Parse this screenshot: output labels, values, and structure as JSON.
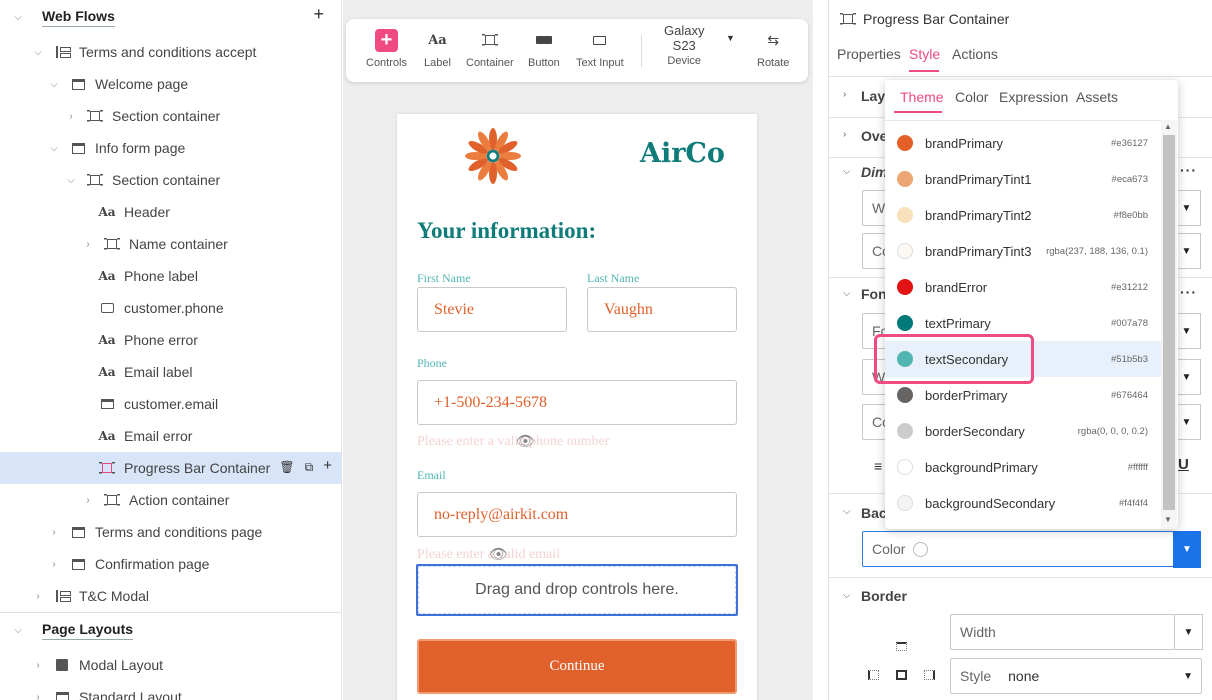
{
  "tree": {
    "web_flows": "Web Flows",
    "terms_flow": "Terms and conditions accept",
    "welcome_page": "Welcome page",
    "section_container_1": "Section container",
    "info_form_page": "Info form page",
    "section_container_2": "Section container",
    "header": "Header",
    "name_container": "Name container",
    "phone_label": "Phone label",
    "customer_phone": "customer.phone",
    "phone_error": "Phone error",
    "email_label": "Email label",
    "customer_email": "customer.email",
    "email_error": "Email error",
    "progress_bar_container": "Progress Bar Container",
    "action_container": "Action container",
    "terms_page": "Terms and conditions page",
    "confirmation_page": "Confirmation page",
    "tc_modal": "T&C Modal",
    "page_layouts": "Page Layouts",
    "modal_layout": "Modal Layout",
    "standard_layout": "Standard Layout"
  },
  "toolbar": {
    "controls": "Controls",
    "label": "Label",
    "container": "Container",
    "button": "Button",
    "text_input": "Text Input",
    "device_line1": "Galaxy",
    "device_line2": "S23",
    "device": "Device",
    "rotate": "Rotate"
  },
  "form": {
    "brand": "AirCo",
    "heading": "Your information:",
    "first_name_label": "First Name",
    "first_name_value": "Stevie",
    "last_name_label": "Last Name",
    "last_name_value": "Vaughn",
    "phone_label": "Phone",
    "phone_value": "+1-500-234-5678",
    "phone_error": "Please enter a valid phone number",
    "email_label": "Email",
    "email_value": "no-reply@airkit.com",
    "email_error": "Please enter a valid email",
    "dropzone": "Drag and drop controls here.",
    "continue": "Continue"
  },
  "props": {
    "title": "Progress Bar Container",
    "tabs": [
      "Properties",
      "Style",
      "Actions"
    ],
    "active_tab": "Style",
    "sections": {
      "layout": "Layout",
      "overflow": "Overflow",
      "dimensions": "Dimensions",
      "font": "Font",
      "background": "Background",
      "border": "Border"
    },
    "dim_width_placeholder": "W",
    "dim_color_placeholder": "Co",
    "font_family_placeholder": "Fo",
    "font_weight_placeholder": "We",
    "font_color_placeholder": "Co",
    "background_color_label": "Color",
    "border_width_placeholder": "Width",
    "border_style_label": "Style",
    "border_style_value": "none"
  },
  "color_picker": {
    "tabs": [
      "Theme",
      "Color",
      "Expression",
      "Assets"
    ],
    "active_tab": "Theme",
    "colors": [
      {
        "name": "brandPrimary",
        "value": "#e36127",
        "swatch": "#e36127"
      },
      {
        "name": "brandPrimaryTint1",
        "value": "#eca673",
        "swatch": "#eca673"
      },
      {
        "name": "brandPrimaryTint2",
        "value": "#f8e0bb",
        "swatch": "#f8e0bb"
      },
      {
        "name": "brandPrimaryTint3",
        "value": "rgba(237, 188, 136, 0.1)",
        "swatch": "rgba(237,188,136,0.1)"
      },
      {
        "name": "brandError",
        "value": "#e31212",
        "swatch": "#e31212"
      },
      {
        "name": "textPrimary",
        "value": "#007a78",
        "swatch": "#007a78"
      },
      {
        "name": "textSecondary",
        "value": "#51b5b3",
        "swatch": "#51b5b3"
      },
      {
        "name": "borderPrimary",
        "value": "#676464",
        "swatch": "#676464"
      },
      {
        "name": "borderSecondary",
        "value": "rgba(0, 0, 0, 0.2)",
        "swatch": "rgba(0,0,0,0.2)"
      },
      {
        "name": "backgroundPrimary",
        "value": "#ffffff",
        "swatch": "#ffffff"
      },
      {
        "name": "backgroundSecondary",
        "value": "#f4f4f4",
        "swatch": "#f4f4f4"
      }
    ],
    "highlighted": "textSecondary"
  },
  "colors": {
    "accent": "#ef4a82",
    "selection": "#d8e4f8",
    "brand_teal": "#0f7c7a",
    "brand_orange": "#e0612c",
    "focus_blue": "#3f6fd8"
  }
}
